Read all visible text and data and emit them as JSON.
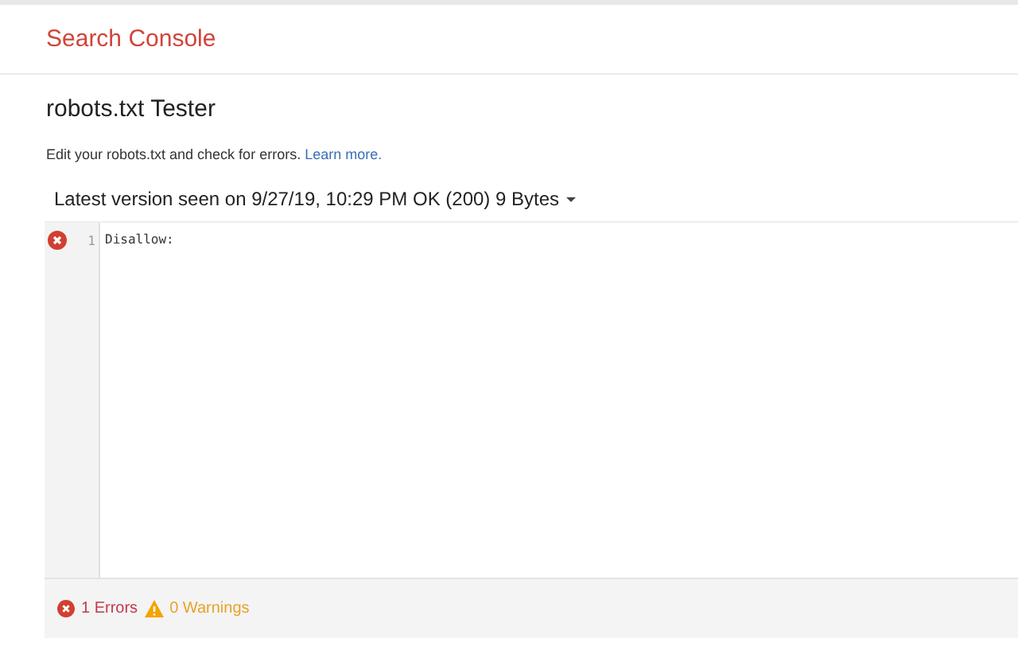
{
  "header": {
    "title": "Search Console"
  },
  "page": {
    "title": "robots.txt Tester",
    "description": "Edit your robots.txt and check for errors.",
    "link": "Learn more."
  },
  "version": {
    "label": "Latest version seen on 9/27/19, 10:29 PM OK (200) 9 Bytes"
  },
  "editor": {
    "lines": [
      {
        "number": "1",
        "text": "Disallow:",
        "error": true
      }
    ]
  },
  "status": {
    "errors": "1 Errors",
    "warnings": "0 Warnings"
  }
}
